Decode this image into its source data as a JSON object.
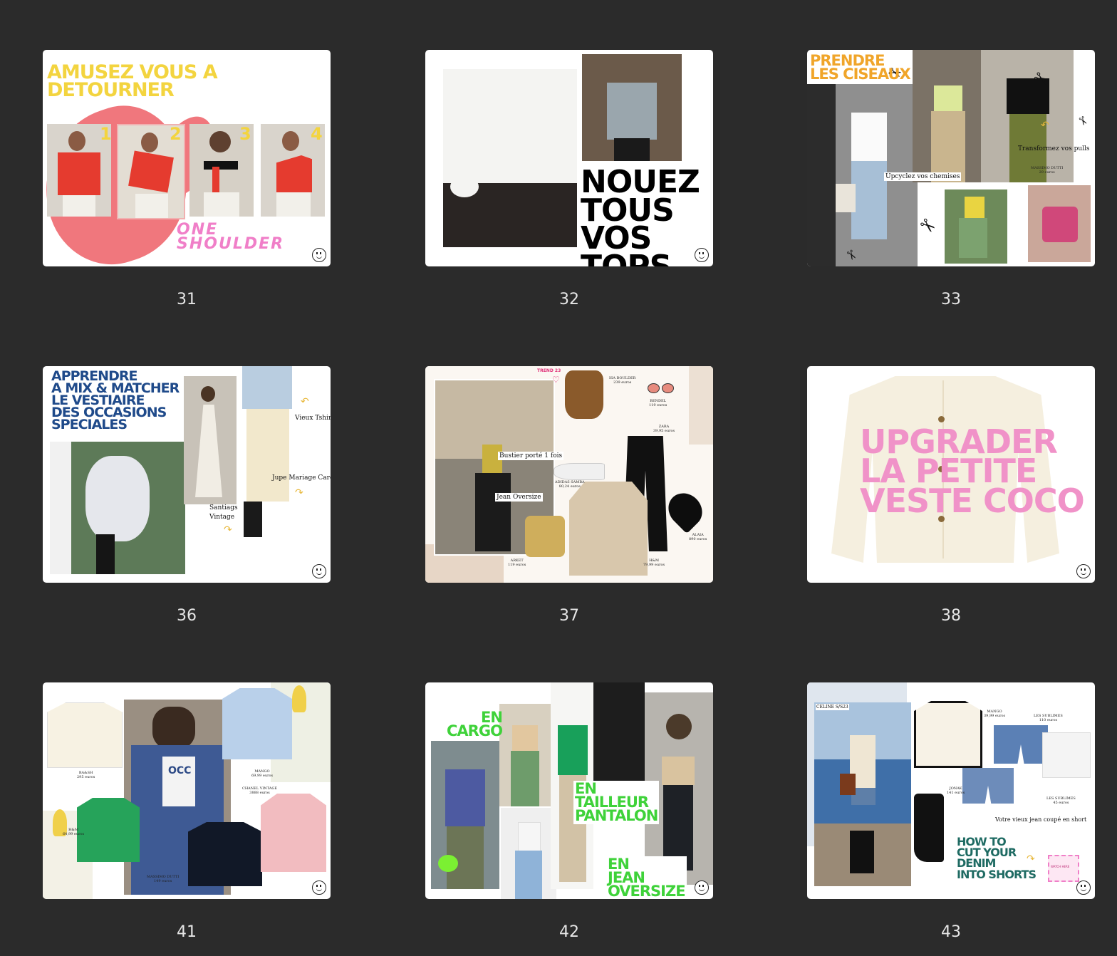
{
  "slides": [
    {
      "number": "31",
      "title": "AMUSEZ VOUS A DETOURNER",
      "steps": [
        "1",
        "2",
        "3",
        "4"
      ],
      "subtitle": "ONE SHOULDER"
    },
    {
      "number": "32",
      "title_lines": [
        "NOUEZ",
        "TOUS",
        "VOS TOPS"
      ]
    },
    {
      "number": "33",
      "title_lines": [
        "PRENDRE",
        "LES CISEAUX"
      ],
      "captions": {
        "pulls": "Transformez vos pulls",
        "chemises": "Upcyclez vos chemises",
        "massimo": "MASSIMO DUTTI",
        "massimo_price": "29 euros"
      }
    },
    {
      "number": "36",
      "title_lines": [
        "APPRENDRE",
        "A MIX & MATCHER",
        "LE VESTIAIRE",
        "DES OCCASIONS",
        "SPECIALES"
      ],
      "captions": {
        "tshirt": "Vieux Tshirt",
        "jupe": "Jupe Mariage Caro",
        "santiags": "Santiags",
        "vintage": "Vintage"
      }
    },
    {
      "number": "37",
      "tag": "TREND 23",
      "captions": {
        "bustier": "Bustier porté 1 fois",
        "jean": "Jean Oversize",
        "isa": "ISA BOULDER",
        "isa_price": "239 euros",
        "bendel": "BENDEL",
        "bendel_price": "119 euros",
        "zara": "ZARA",
        "zara_price": "39,95 euros",
        "adidas": "ADIDAS SAMBA",
        "adidas_price": "80,24 euros",
        "alaia": "ALAIA",
        "alaia_price": "890 euros",
        "arket": "ARKET",
        "arket_price": "119 euros",
        "hm": "H&M",
        "hm_price": "79,99 euros"
      }
    },
    {
      "number": "38",
      "title_lines": [
        "UPGRADER",
        "LA PETITE",
        "VESTE COCO"
      ]
    },
    {
      "number": "41",
      "captions": {
        "baash": "BA&SH",
        "baash_price": "295 euros",
        "mango": "MANGO",
        "mango_price": "69,99 euros",
        "chanel": "CHANEL VINTAGE",
        "chanel_price": "3888 euros",
        "hm": "H&M",
        "hm_price": "64,99 euros",
        "massimo": "MASSIMO DUTTI",
        "massimo_price": "149 euros",
        "sweat": "OCC"
      }
    },
    {
      "number": "42",
      "labels": {
        "cargo": [
          "EN",
          "CARGO"
        ],
        "tailleur": [
          "EN",
          "TAILLEUR",
          "PANTALON"
        ],
        "jean": [
          "EN",
          "JEAN",
          "OVERSIZE"
        ]
      }
    },
    {
      "number": "43",
      "captions": {
        "celine": "CELINE S/S23",
        "mango": "MANGO",
        "mango_price": "39,99 euros",
        "sublimes1": "LES SUBLIMES",
        "sublimes1_price": "110 euros",
        "jonak": "JONAK",
        "jonak_price": "141 euros",
        "sublimes2": "LES SUBLIMES",
        "sublimes2_price": "45 euros",
        "short": "Votre vieux jean coupé en short",
        "watch": "WATCH HERE"
      },
      "title_lines": [
        "HOW TO",
        "CUT YOUR",
        "DENIM",
        "INTO SHORTS"
      ]
    }
  ],
  "colors": {
    "background": "#2b2b2b",
    "yellow": "#f3d43f",
    "pink": "#f07fc8",
    "navy": "#1f4a8a",
    "green": "#3fd23a",
    "teal": "#1f6b63",
    "orange": "#f0a52a"
  }
}
